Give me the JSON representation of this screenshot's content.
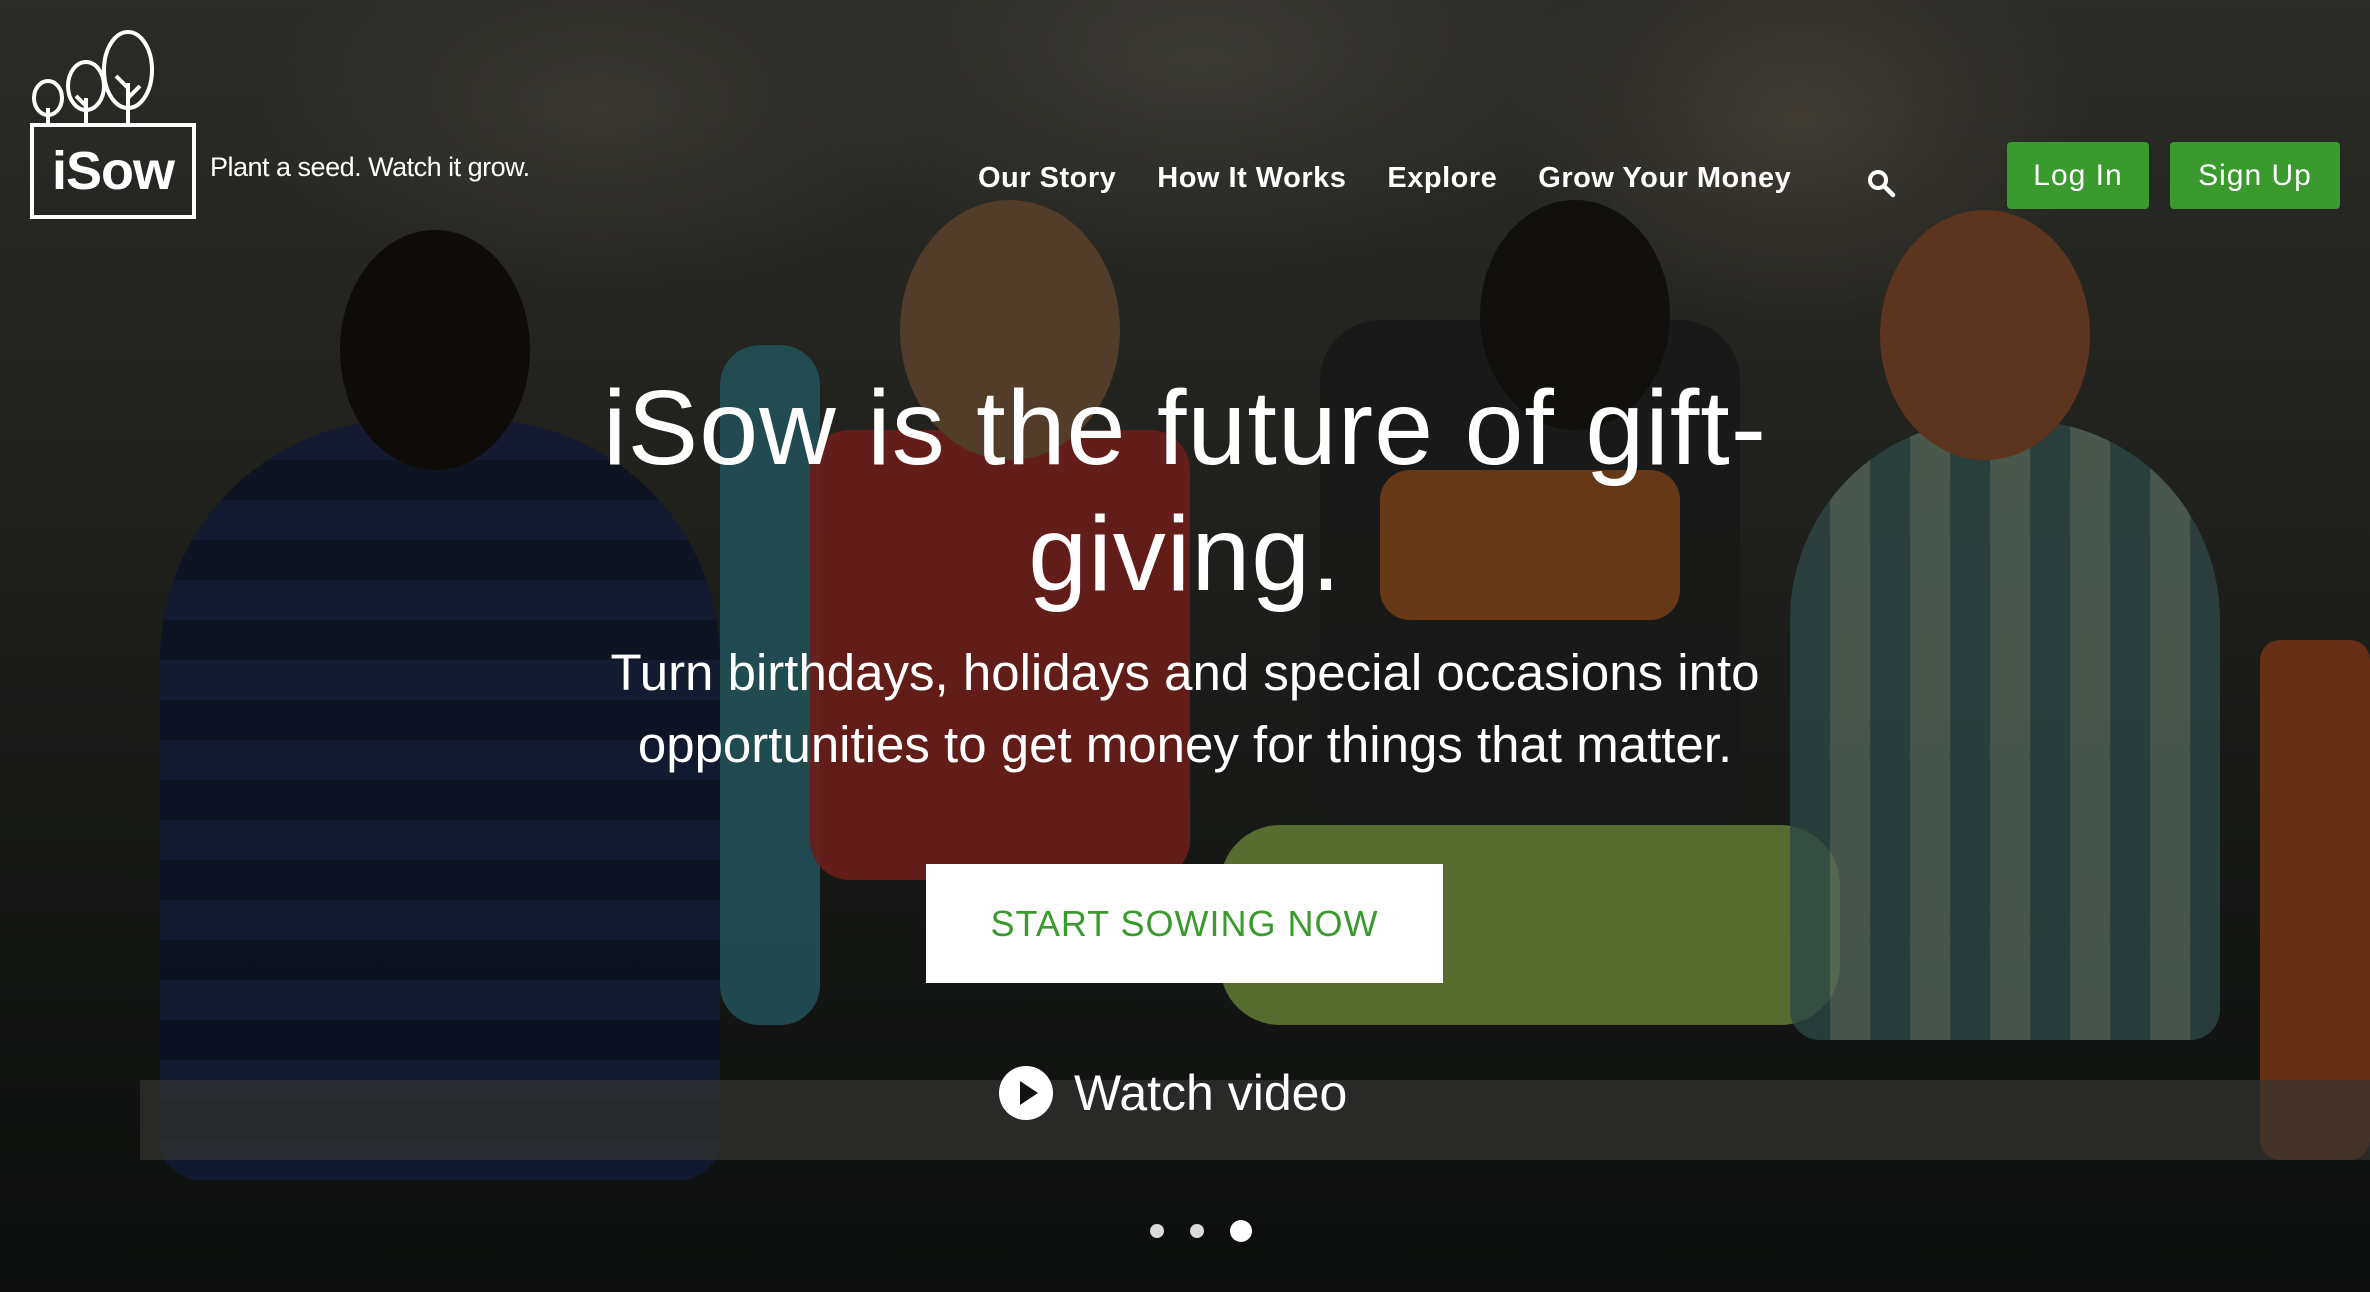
{
  "brand": {
    "logo_text": "iSow",
    "tagline": "Plant a seed. Watch it grow."
  },
  "nav": {
    "items": [
      {
        "label": "Our Story"
      },
      {
        "label": "How It Works"
      },
      {
        "label": "Explore"
      },
      {
        "label": "Grow Your Money"
      }
    ],
    "search_icon": "search-icon"
  },
  "auth": {
    "login_label": "Log In",
    "signup_label": "Sign Up"
  },
  "hero": {
    "title": "iSow is the future of gift-giving.",
    "subtitle": "Turn birthdays, holidays and special occasions into opportunities to get money for things that matter.",
    "cta_label": "START SOWING NOW",
    "watch_label": "Watch video",
    "play_icon": "play-circle-icon"
  },
  "carousel": {
    "slide_count": 3,
    "active_index": 2
  },
  "colors": {
    "accent": "#3a9a2e",
    "text_light": "#ffffff"
  }
}
